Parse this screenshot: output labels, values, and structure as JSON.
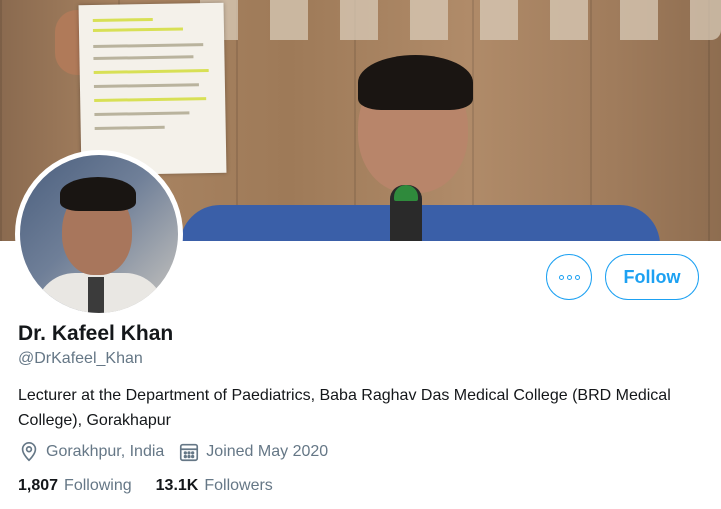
{
  "profile": {
    "name": "Dr. Kafeel Khan",
    "handle": "@DrKafeel_Khan",
    "bio": "Lecturer at the Department of Paediatrics, Baba Raghav Das Medical College (BRD Medical College), Gorakhapur",
    "location": "Gorakhpur, India",
    "joined": "Joined May 2020",
    "following_count": "1,807",
    "following_label": "Following",
    "followers_count": "13.1K",
    "followers_label": "Followers"
  },
  "actions": {
    "follow_label": "Follow",
    "more_icon": "more-options-icon"
  },
  "icons": {
    "location": "location-pin-icon",
    "calendar": "calendar-icon"
  },
  "colors": {
    "accent": "#1da1f2",
    "secondary_text": "#657786",
    "primary_text": "#14171a"
  }
}
